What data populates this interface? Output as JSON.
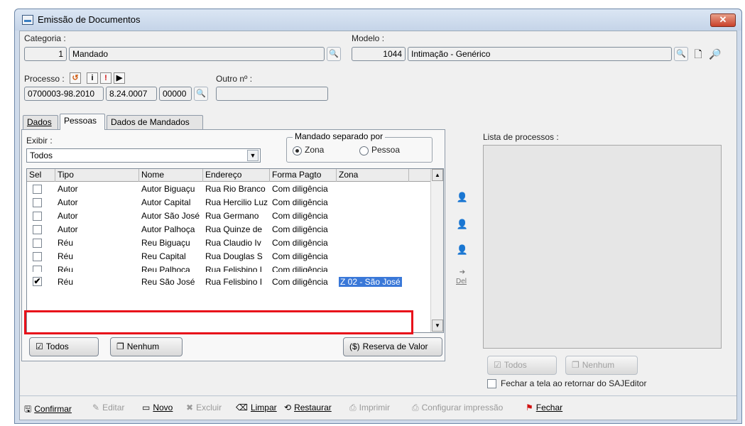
{
  "window": {
    "title": "Emissão de Documentos",
    "close_label": "✕"
  },
  "categoria": {
    "label": "Categoria :",
    "code": "1",
    "name": "Mandado"
  },
  "modelo": {
    "label": "Modelo :",
    "code": "1044",
    "name": "Intimação - Genérico"
  },
  "processo": {
    "label": "Processo :",
    "part1": "0700003-98.2010",
    "part2": "8.24.0007",
    "part3": "00000",
    "outro_label": "Outro nº :",
    "outro_value": ""
  },
  "tabs": [
    {
      "label": "Dados"
    },
    {
      "label": "Pessoas"
    },
    {
      "label": "Dados de Mandados"
    }
  ],
  "exibir": {
    "label": "Exibir :",
    "value": "Todos"
  },
  "mandado_separado": {
    "title": "Mandado separado por",
    "options": [
      "Zona",
      "Pessoa"
    ],
    "selected": "Zona"
  },
  "grid": {
    "columns": [
      "Sel",
      "Tipo",
      "Nome",
      "Endereço",
      "Forma Pagto",
      "Zona"
    ],
    "rows": [
      {
        "sel": false,
        "tipo": "Autor",
        "nome": "Autor Biguaçu",
        "endereco": "Rua Rio Branco",
        "forma": "Com diligência",
        "zona": ""
      },
      {
        "sel": false,
        "tipo": "Autor",
        "nome": "Autor Capital",
        "endereco": "Rua Hercilio Luz",
        "forma": "Com diligência",
        "zona": ""
      },
      {
        "sel": false,
        "tipo": "Autor",
        "nome": "Autor São José",
        "endereco": "Rua Germano",
        "forma": "Com diligência",
        "zona": ""
      },
      {
        "sel": false,
        "tipo": "Autor",
        "nome": "Autor Palhoça",
        "endereco": "Rua Quinze de",
        "forma": "Com diligência",
        "zona": ""
      },
      {
        "sel": false,
        "tipo": "Réu",
        "nome": "Reu Biguaçu",
        "endereco": "Rua Claudio Iv",
        "forma": "Com diligência",
        "zona": ""
      },
      {
        "sel": false,
        "tipo": "Réu",
        "nome": "Reu Capital",
        "endereco": "Rua Douglas S",
        "forma": "Com diligência",
        "zona": ""
      },
      {
        "sel": false,
        "tipo": "Réu",
        "nome": "Reu Palhoça",
        "endereco": "Rua Felisbino L",
        "forma": "Com diligência",
        "zona": ""
      },
      {
        "sel": true,
        "tipo": "Réu",
        "nome": "Reu São José",
        "endereco": "Rua Felisbino I",
        "forma": "Com diligência",
        "zona": "Z 02 - São José"
      }
    ]
  },
  "buttons": {
    "todos": "Todos",
    "nenhum": "Nenhum",
    "reserva": "Reserva de Valor",
    "del": "Del"
  },
  "lista": {
    "label": "Lista de processos :",
    "todos": "Todos",
    "nenhum": "Nenhum",
    "fechar_label": "Fechar a tela ao retornar do SAJEditor"
  },
  "toolbar": [
    {
      "label": "Confirmar",
      "enabled": true,
      "icon": "save-icon"
    },
    {
      "label": "Editar",
      "enabled": false,
      "icon": "edit-icon"
    },
    {
      "label": "Novo",
      "enabled": true,
      "icon": "new-icon"
    },
    {
      "label": "Excluir",
      "enabled": false,
      "icon": "delete-icon"
    },
    {
      "label": "Limpar",
      "enabled": true,
      "icon": "clear-icon"
    },
    {
      "label": "Restaurar",
      "enabled": true,
      "icon": "restore-icon"
    },
    {
      "label": "Imprimir",
      "enabled": false,
      "icon": "print-icon"
    },
    {
      "label": "Configurar impressão",
      "enabled": false,
      "icon": "print-settings-icon"
    },
    {
      "label": "Fechar",
      "enabled": true,
      "icon": "close-icon"
    }
  ],
  "colors": {
    "highlight": "#e8101a",
    "selection": "#3a78d8"
  }
}
